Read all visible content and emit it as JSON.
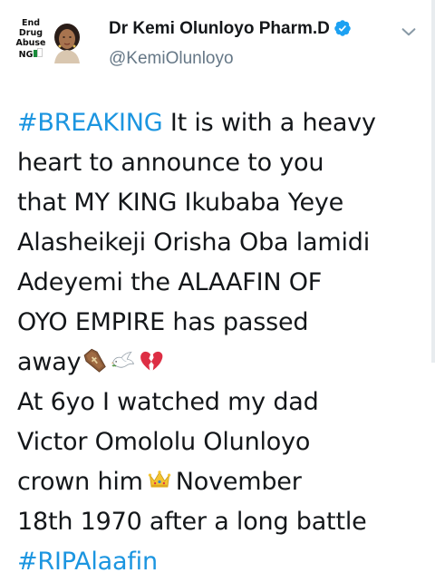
{
  "user": {
    "display_name": "Dr Kemi Olunloyo Pharm.D",
    "handle": "@KemiOlunloyo",
    "verified": true,
    "avatar_text": [
      "End",
      "Drug",
      "Abuse",
      "NG"
    ]
  },
  "tweet": {
    "lines": [
      {
        "hashtag": "#BREAKING",
        "text": " It is with a heavy"
      },
      {
        "text": "heart to announce to you"
      },
      {
        "text": "that MY KING Ikubaba Yeye"
      },
      {
        "text": "Alasheikeji Orisha Oba lamidi"
      },
      {
        "text": "Adeyemi the ALAAFIN OF"
      },
      {
        "text": "OYO EMPIRE has passed"
      },
      {
        "text": "away",
        "emojis": [
          "coffin-emoji",
          "dove-emoji",
          "broken-heart-emoji"
        ]
      },
      {
        "text": "At 6yo I watched my dad"
      },
      {
        "text": "Victor Omololu Olunloyo"
      },
      {
        "text": "crown him",
        "emoji_inline": "crown-emoji",
        "text_after": "November"
      },
      {
        "text": "18th 1970 after a long battle"
      },
      {
        "hashtag": "#RIPAlaafin"
      }
    ]
  },
  "colors": {
    "hashtag": "#1b95e0",
    "verified_badge": "#1da1f2",
    "handle": "#657786",
    "text": "#14171a"
  },
  "icons": {
    "verified": "verified-badge-icon",
    "menu": "chevron-down-icon"
  }
}
